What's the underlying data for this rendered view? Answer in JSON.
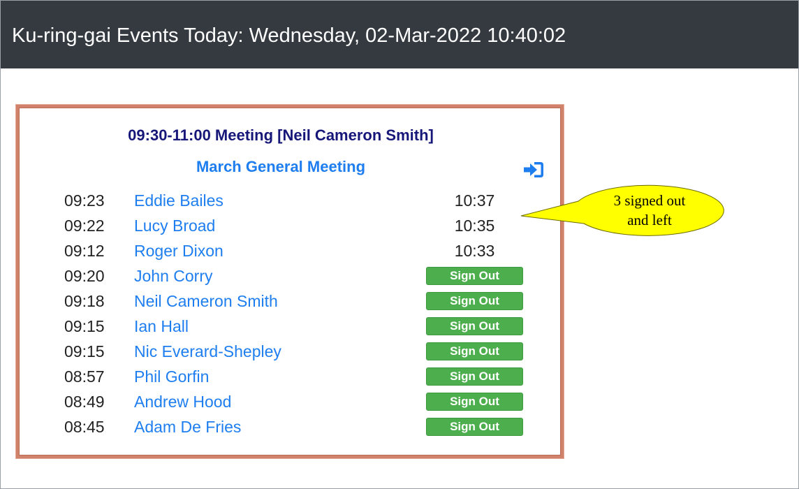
{
  "header": {
    "title": "Ku-ring-gai Events Today: Wednesday, 02-Mar-2022 10:40:02"
  },
  "event": {
    "heading": "09:30-11:00 Meeting [Neil Cameron Smith]",
    "title": "March General Meeting",
    "signin_icon": "sign-in-icon"
  },
  "attendees": [
    {
      "time_in": "09:23",
      "name": "Eddie Bailes",
      "time_out": "10:37"
    },
    {
      "time_in": "09:22",
      "name": "Lucy Broad",
      "time_out": "10:35"
    },
    {
      "time_in": "09:12",
      "name": "Roger Dixon",
      "time_out": "10:33"
    },
    {
      "time_in": "09:20",
      "name": "John Corry",
      "button": "Sign Out"
    },
    {
      "time_in": "09:18",
      "name": "Neil Cameron Smith",
      "button": "Sign Out"
    },
    {
      "time_in": "09:15",
      "name": "Ian Hall",
      "button": "Sign Out"
    },
    {
      "time_in": "09:15",
      "name": "Nic Everard-Shepley",
      "button": "Sign Out"
    },
    {
      "time_in": "08:57",
      "name": "Phil Gorfin",
      "button": "Sign Out"
    },
    {
      "time_in": "08:49",
      "name": "Andrew Hood",
      "button": "Sign Out"
    },
    {
      "time_in": "08:45",
      "name": "Adam De Fries",
      "button": "Sign Out"
    }
  ],
  "callout": {
    "line1": "3 signed out",
    "line2": "and left"
  },
  "colors": {
    "header_bg": "#343a40",
    "heading": "#17177a",
    "link": "#1e7ef0",
    "button": "#4cae4c",
    "card_border": "#d0826a",
    "callout_fill": "#ffff00"
  }
}
